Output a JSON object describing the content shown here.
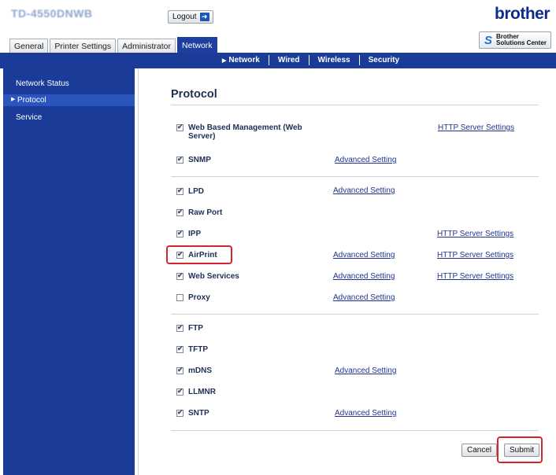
{
  "header": {
    "model_name": "TD-4550DNWB",
    "logout_label": "Logout",
    "brand": "brother",
    "solutions_line1": "Brother",
    "solutions_line2": "Solutions Center"
  },
  "tabs": [
    {
      "label": "General",
      "active": false
    },
    {
      "label": "Printer Settings",
      "active": false
    },
    {
      "label": "Administrator",
      "active": false
    },
    {
      "label": "Network",
      "active": true
    }
  ],
  "subnav": {
    "items": [
      {
        "label": "Network",
        "active": true
      },
      {
        "label": "Wired",
        "active": false
      },
      {
        "label": "Wireless",
        "active": false
      },
      {
        "label": "Security",
        "active": false
      }
    ]
  },
  "sidebar": {
    "items": [
      {
        "label": "Network Status",
        "selected": false
      },
      {
        "label": "Protocol",
        "selected": true
      },
      {
        "label": "Service",
        "selected": false
      }
    ]
  },
  "page": {
    "title": "Protocol",
    "protocols": [
      {
        "label": "Web Based Management (Web Server)",
        "checked": true,
        "advanced_link": "",
        "http_link": "HTTP Server Settings"
      },
      {
        "label": "SNMP",
        "checked": true,
        "advanced_link": "Advanced Setting",
        "http_link": ""
      },
      {
        "label": "LPD",
        "checked": true,
        "advanced_link": "Advanced Setting",
        "http_link": ""
      },
      {
        "label": "Raw Port",
        "checked": true,
        "advanced_link": "",
        "http_link": ""
      },
      {
        "label": "IPP",
        "checked": true,
        "advanced_link": "",
        "http_link": "HTTP Server Settings"
      },
      {
        "label": "AirPrint",
        "checked": true,
        "advanced_link": "Advanced Setting",
        "http_link": "HTTP Server Settings",
        "highlighted": true
      },
      {
        "label": "Web Services",
        "checked": true,
        "advanced_link": "Advanced Setting",
        "http_link": "HTTP Server Settings"
      },
      {
        "label": "Proxy",
        "checked": false,
        "advanced_link": "Advanced Setting",
        "http_link": ""
      },
      {
        "label": "FTP",
        "checked": true,
        "advanced_link": "",
        "http_link": ""
      },
      {
        "label": "TFTP",
        "checked": true,
        "advanced_link": "",
        "http_link": ""
      },
      {
        "label": "mDNS",
        "checked": true,
        "advanced_link": "Advanced Setting",
        "http_link": ""
      },
      {
        "label": "LLMNR",
        "checked": true,
        "advanced_link": "",
        "http_link": ""
      },
      {
        "label": "SNTP",
        "checked": true,
        "advanced_link": "Advanced Setting",
        "http_link": ""
      }
    ],
    "cancel_label": "Cancel",
    "submit_label": "Submit"
  },
  "colors": {
    "nav_blue": "#1a3c98",
    "highlight_red": "#d6262d",
    "link_blue": "#22348f"
  }
}
